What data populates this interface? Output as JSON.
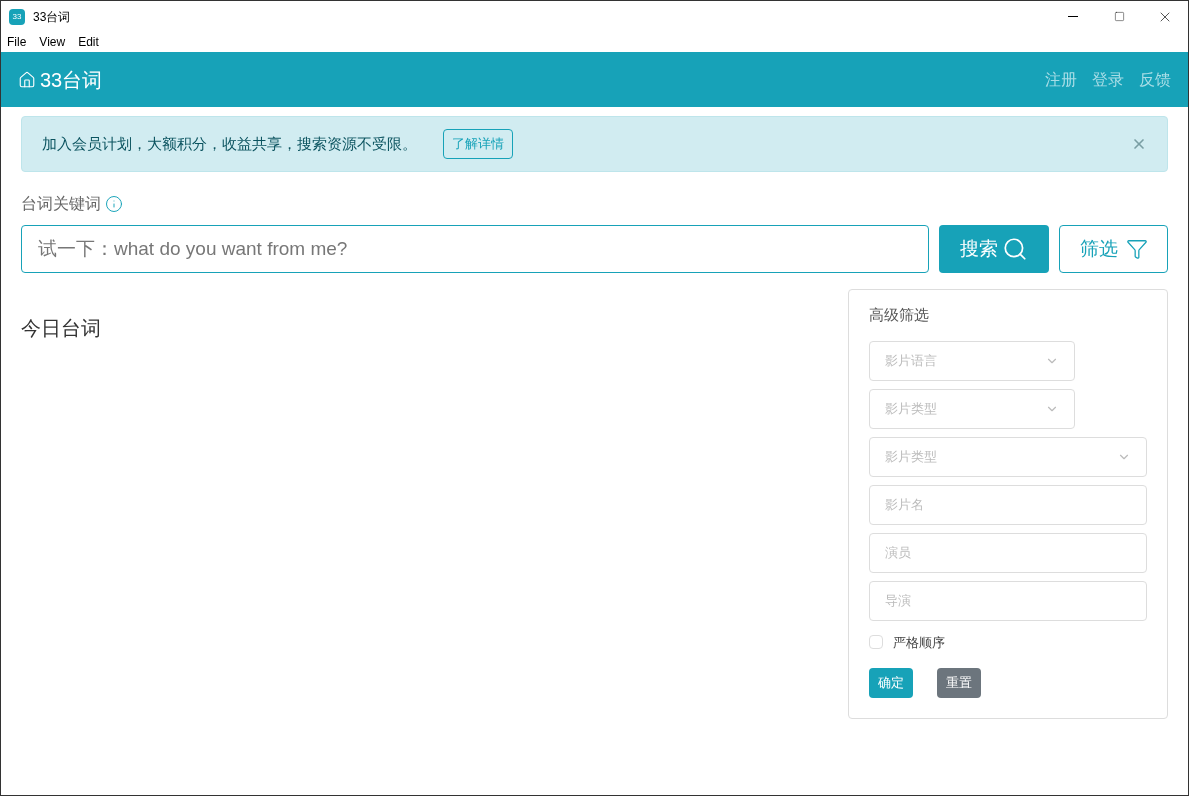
{
  "window": {
    "icon_text": "33",
    "title": "33台词"
  },
  "menu": [
    "File",
    "View",
    "Edit"
  ],
  "header": {
    "brand": "33台词",
    "links": [
      "注册",
      "登录",
      "反馈"
    ]
  },
  "alert": {
    "text": "加入会员计划，大额积分，收益共享，搜索资源不受限。",
    "button": "了解详情"
  },
  "search": {
    "label": "台词关键词",
    "placeholder": "试一下：what do you want from me?",
    "search_button": "搜索",
    "filter_button": "筛选"
  },
  "today": {
    "title": "今日台词"
  },
  "filter_panel": {
    "title": "高级筛选",
    "fields": [
      {
        "kind": "select",
        "placeholder": "影片语言",
        "compact": true
      },
      {
        "kind": "select",
        "placeholder": "影片类型",
        "compact": true
      },
      {
        "kind": "select",
        "placeholder": "影片类型",
        "compact": false
      },
      {
        "kind": "input",
        "placeholder": "影片名",
        "compact": false
      },
      {
        "kind": "input",
        "placeholder": "演员",
        "compact": false
      },
      {
        "kind": "input",
        "placeholder": "导演",
        "compact": false
      }
    ],
    "strict_order": {
      "label": "严格顺序",
      "checked": false
    },
    "buttons": [
      {
        "kind": "primary",
        "label": "确定"
      },
      {
        "kind": "secondary",
        "label": "重置"
      }
    ]
  }
}
